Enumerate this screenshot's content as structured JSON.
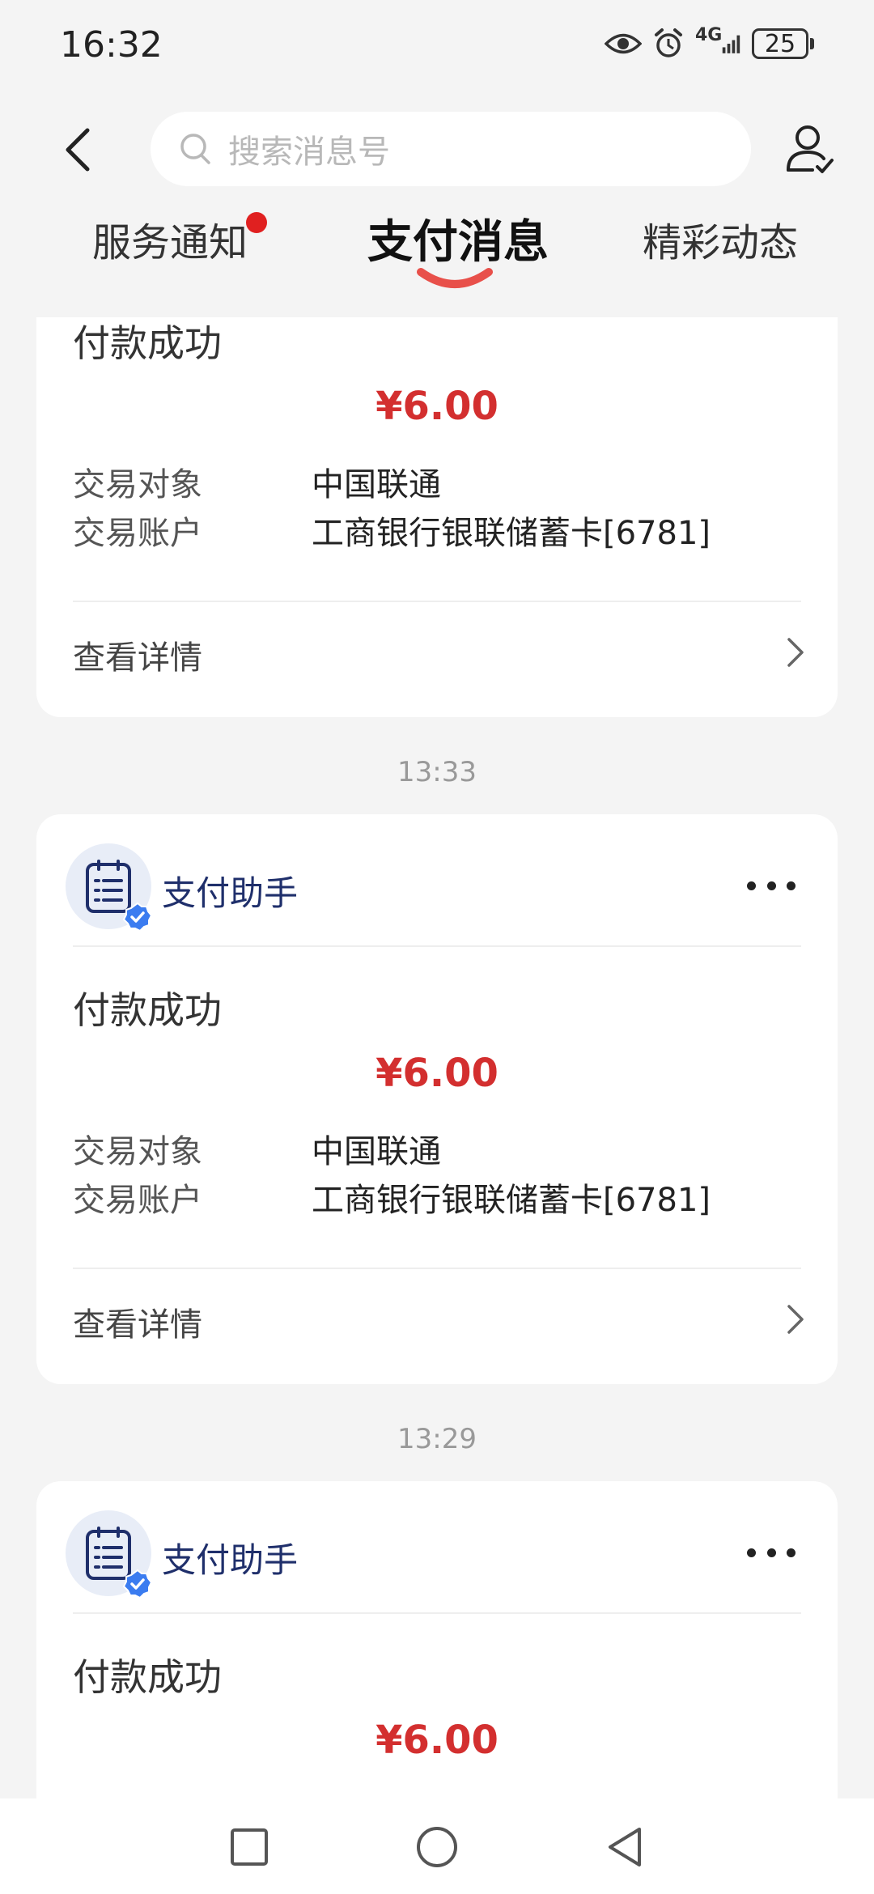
{
  "status_bar": {
    "time": "16:32",
    "network": "4G",
    "battery": "25",
    "icons": [
      "eye-icon",
      "alarm-icon",
      "signal-icon",
      "battery-icon"
    ]
  },
  "header": {
    "search_placeholder": "搜索消息号",
    "back_icon": "chevron-left-icon",
    "profile_icon": "person-check-icon"
  },
  "tabs": [
    {
      "label": "服务通知",
      "active": false,
      "badge": true
    },
    {
      "label": "支付消息",
      "active": true,
      "badge": false
    },
    {
      "label": "精彩动态",
      "active": false,
      "badge": false
    }
  ],
  "messages": [
    {
      "title": "付款成功",
      "amount": "¥6.00",
      "rows": [
        {
          "label": "交易对象",
          "value": "中国联通"
        },
        {
          "label": "交易账户",
          "value": "工商银行银联储蓄卡[6781]"
        }
      ],
      "details": "查看详情"
    },
    {
      "time": "13:33",
      "sender": "支付助手",
      "title": "付款成功",
      "amount": "¥6.00",
      "rows": [
        {
          "label": "交易对象",
          "value": "中国联通"
        },
        {
          "label": "交易账户",
          "value": "工商银行银联储蓄卡[6781]"
        }
      ],
      "details": "查看详情"
    },
    {
      "time": "13:29",
      "sender": "支付助手",
      "title": "付款成功",
      "amount": "¥6.00"
    }
  ],
  "colors": {
    "accent": "#d32f2f",
    "tab_indicator": "#e8504a",
    "sender": "#1f2f6b",
    "verified": "#3b7cf0"
  }
}
